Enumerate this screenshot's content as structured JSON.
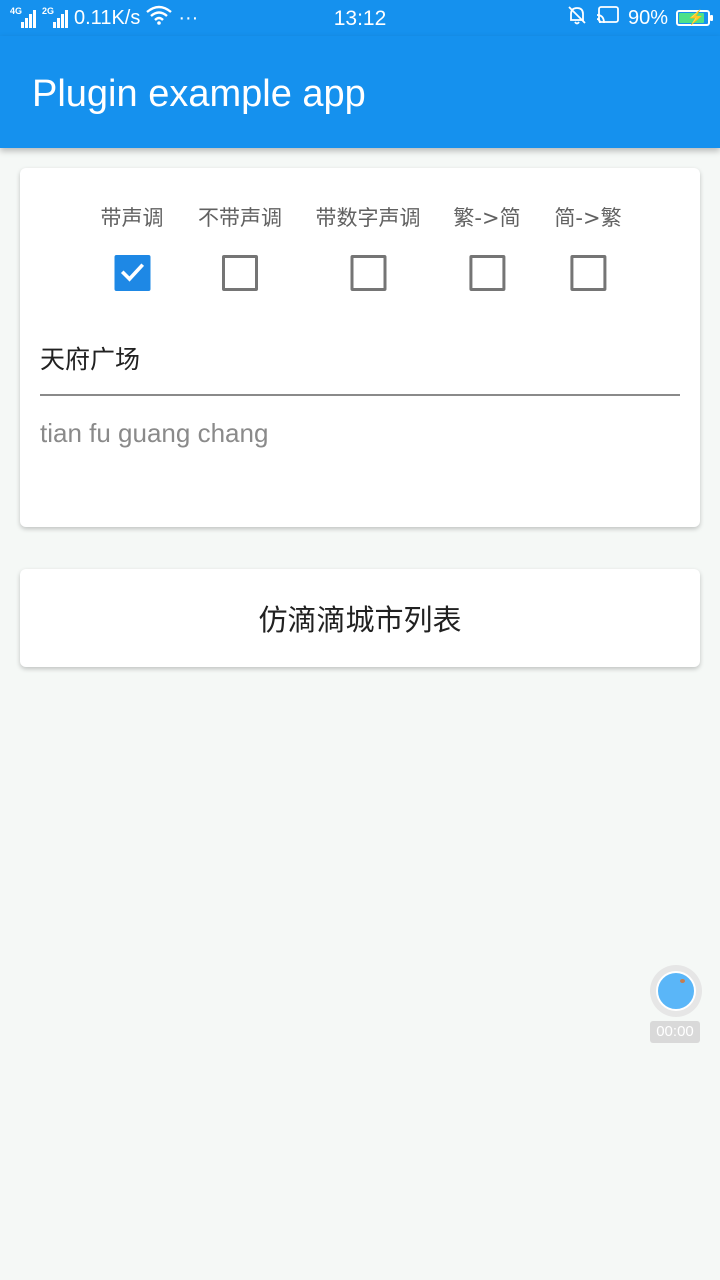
{
  "status_bar": {
    "network_4g": "4G",
    "network_2g": "2G",
    "speed": "0.11K/s",
    "more": "···",
    "time": "13:12",
    "battery": "90%",
    "battery_level": 0.9,
    "icons": [
      "signal-4g-icon",
      "signal-2g-icon",
      "wifi-icon",
      "bell-off-icon",
      "cast-icon",
      "battery-charging-icon"
    ]
  },
  "appbar": {
    "title": "Plugin example app",
    "color": "#1591ee"
  },
  "options": [
    {
      "label": "带声调",
      "checked": true
    },
    {
      "label": "不带声调",
      "checked": false
    },
    {
      "label": "带数字声调",
      "checked": false
    },
    {
      "label": "繁->简",
      "checked": false
    },
    {
      "label": "简->繁",
      "checked": false
    }
  ],
  "input": {
    "value": "天府广场"
  },
  "result": {
    "text": "tian fu guang chang"
  },
  "city_list_button": {
    "label": "仿滴滴城市列表"
  },
  "recorder": {
    "time": "00:00"
  },
  "colors": {
    "accent": "#1e88e5",
    "background": "#f5f8f6"
  }
}
